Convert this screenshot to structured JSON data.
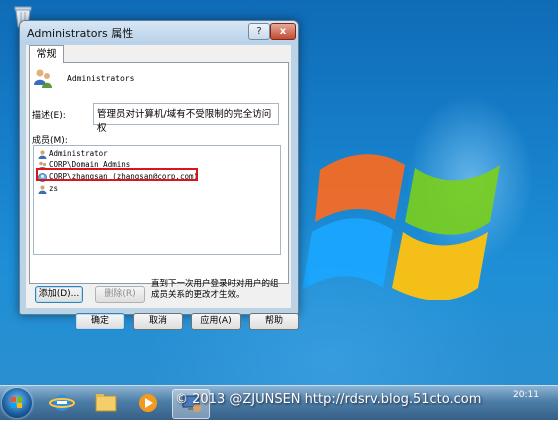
{
  "window": {
    "title": "Administrators 属性",
    "help_label": "?",
    "close_label": "x"
  },
  "tabs": [
    {
      "label": "常规"
    }
  ],
  "group": {
    "name": "Administrators"
  },
  "description": {
    "label": "描述(E):",
    "value": "管理员对计算机/域有不受限制的完全访问权"
  },
  "members": {
    "label": "成员(M):",
    "items": [
      {
        "name": "Administrator"
      },
      {
        "name": "CORP\\Domain Admins"
      },
      {
        "name": "CORP\\zhangsan (zhangsan@corp.com)"
      },
      {
        "name": "zs"
      }
    ],
    "highlighted_index": 2
  },
  "buttons": {
    "add": "添加(D)...",
    "remove": "删除(R)",
    "ok": "确定",
    "cancel": "取消",
    "apply": "应用(A)",
    "help": "帮助"
  },
  "note": "直到下一次用户登录时对用户的组成员关系的更改才生效。",
  "taskbar": {
    "watermark": "© 2013 @ZJUNSEN http://rdsrv.blog.51cto.com",
    "clock": "20:11"
  },
  "colors": {
    "highlight_border": "#d8161c",
    "taskbar": "#4c7ea8",
    "desktop": "#1780cb"
  }
}
